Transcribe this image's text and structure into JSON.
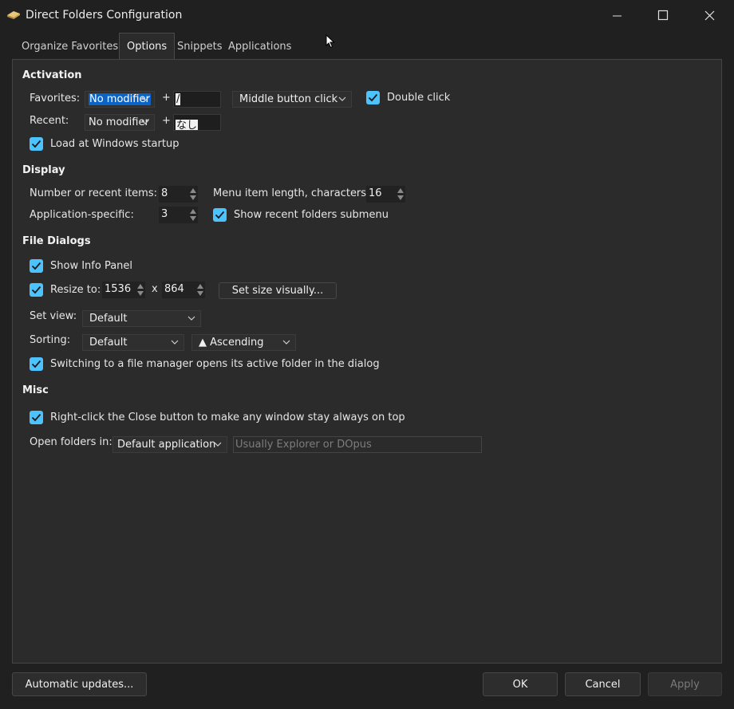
{
  "window": {
    "title": "Direct Folders Configuration"
  },
  "tabs": [
    {
      "label": "Organize Favorites"
    },
    {
      "label": "Options"
    },
    {
      "label": "Snippets"
    },
    {
      "label": "Applications"
    }
  ],
  "activation": {
    "heading": "Activation",
    "favorites_label": "Favorites:",
    "favorites_modifier": "No modifier",
    "plus": "+",
    "favorites_key": "/",
    "mouse_option": "Middle button click",
    "double_click_label": "Double click",
    "recent_label": "Recent:",
    "recent_modifier": "No modifier",
    "recent_key": "なし",
    "startup_label": "Load at Windows startup"
  },
  "display": {
    "heading": "Display",
    "recent_items_label": "Number or recent items:",
    "recent_items_value": "8",
    "menu_length_label": "Menu item length, characters:",
    "menu_length_value": "16",
    "app_specific_label": "Application-specific:",
    "app_specific_value": "3",
    "submenu_label": "Show recent folders submenu"
  },
  "file_dialogs": {
    "heading": "File Dialogs",
    "info_panel_label": "Show Info Panel",
    "resize_label": "Resize to:",
    "width": "1536",
    "times": "x",
    "height": "864",
    "set_size_button": "Set size visually...",
    "set_view_label": "Set view:",
    "set_view_value": "Default",
    "sorting_label": "Sorting:",
    "sorting_value": "Default",
    "order_value": "▲ Ascending",
    "switching_label": "Switching to a file manager opens its active folder in the dialog"
  },
  "misc": {
    "heading": "Misc",
    "right_click_label": "Right-click the Close button to make any window stay always on top",
    "open_folders_label": "Open folders in:",
    "open_folders_value": "Default application",
    "open_folders_placeholder": "Usually Explorer or DOpus"
  },
  "footer": {
    "updates_button": "Automatic updates...",
    "ok_button": "OK",
    "cancel_button": "Cancel",
    "apply_button": "Apply"
  },
  "colors": {
    "accent": "#4cc2ff",
    "background": "#202020",
    "panel": "#2b2b2b",
    "selection": "#0a64c8"
  }
}
